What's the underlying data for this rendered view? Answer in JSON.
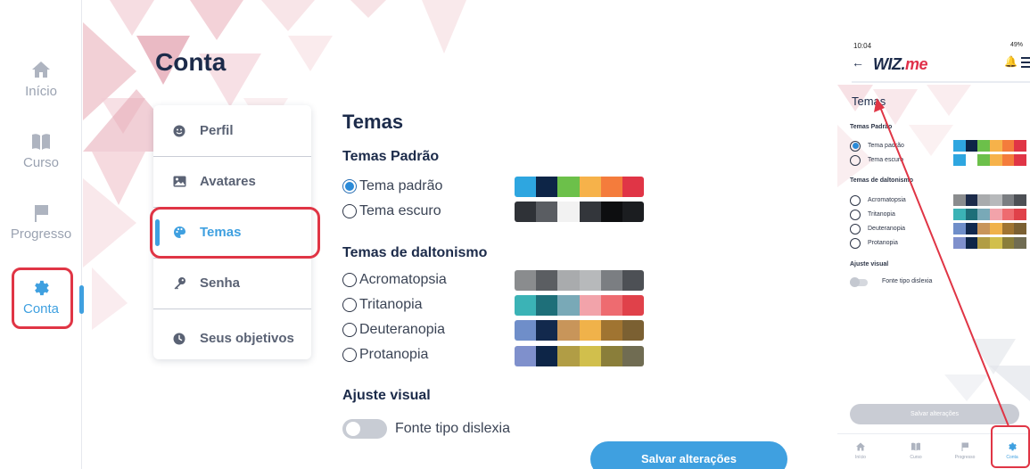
{
  "nav": {
    "items": [
      {
        "label": "Início",
        "icon": "home-icon"
      },
      {
        "label": "Curso",
        "icon": "book-icon"
      },
      {
        "label": "Progresso",
        "icon": "flag-icon"
      },
      {
        "label": "Conta",
        "icon": "gear-icon",
        "active": true
      }
    ]
  },
  "page": {
    "title": "Conta"
  },
  "menu": {
    "items": [
      {
        "label": "Perfil",
        "icon": "smile-icon"
      },
      {
        "label": "Avatares",
        "icon": "image-icon"
      },
      {
        "label": "Temas",
        "icon": "palette-icon",
        "active": true
      },
      {
        "label": "Senha",
        "icon": "key-icon"
      },
      {
        "label": "Seus objetivos",
        "icon": "clock-icon"
      }
    ]
  },
  "themes": {
    "title": "Temas",
    "default_section": "Temas Padrão",
    "default_options": [
      {
        "label": "Tema padrão",
        "selected": true,
        "colors": [
          "#2ea6e0",
          "#0d2547",
          "#6cc04a",
          "#f6b24a",
          "#f47c3c",
          "#e03546"
        ]
      },
      {
        "label": "Tema escuro",
        "selected": false,
        "colors": [
          "#2f3237",
          "#5a5d62",
          "#f2f2f2",
          "#33363b",
          "#0d0e10",
          "#1b1d20"
        ]
      }
    ],
    "colorblind_section": "Temas de daltonismo",
    "colorblind_options": [
      {
        "label": "Acromatopsia",
        "selected": false,
        "colors": [
          "#8a8c8e",
          "#5b5e62",
          "#a9abad",
          "#b7b9bb",
          "#7b7e82",
          "#4d5055"
        ]
      },
      {
        "label": "Tritanopia",
        "selected": false,
        "colors": [
          "#3bb3b6",
          "#1e6f79",
          "#79a9b7",
          "#f2a3aa",
          "#ee6b70",
          "#e0414a"
        ]
      },
      {
        "label": "Deuteranopia",
        "selected": false,
        "colors": [
          "#6f8ec9",
          "#12294d",
          "#c8955a",
          "#f0b24a",
          "#a07431",
          "#7b6032"
        ]
      },
      {
        "label": "Protanopia",
        "selected": false,
        "colors": [
          "#7f90cc",
          "#0d2547",
          "#b19d45",
          "#d1bf4c",
          "#8a7e3a",
          "#706c52"
        ]
      }
    ],
    "visual_section": "Ajuste visual",
    "dyslexia_label": "Fonte tipo dislexia",
    "save_label": "Salvar alterações"
  },
  "phone": {
    "time": "10:04",
    "status_right": "49%",
    "logo_prefix": "WIZ.",
    "logo_suffix": "me",
    "title": "Temas",
    "default_section": "Temas Padrão",
    "default_options": [
      {
        "label": "Tema padrão",
        "selected": true,
        "colors": [
          "#2ea6e0",
          "#0d2547",
          "#6cc04a",
          "#f6b24a",
          "#f47c3c",
          "#e03546"
        ]
      },
      {
        "label": "Tema escuro",
        "selected": false,
        "colors": [
          "#2ea6e0",
          "#ffffff",
          "#6cc04a",
          "#f6b24a",
          "#f47c3c",
          "#e03546"
        ]
      }
    ],
    "colorblind_section": "Temas de daltonismo",
    "colorblind_options": [
      {
        "label": "Acromatopsia",
        "selected": false,
        "colors": [
          "#8a8c8e",
          "#1c2b4a",
          "#a9abad",
          "#b7b9bb",
          "#7b7e82",
          "#4d5055"
        ]
      },
      {
        "label": "Tritanopia",
        "selected": false,
        "colors": [
          "#3bb3b6",
          "#1e6f79",
          "#79a9b7",
          "#f2a3aa",
          "#ee6b70",
          "#e0414a"
        ]
      },
      {
        "label": "Deuteranopia",
        "selected": false,
        "colors": [
          "#6f8ec9",
          "#12294d",
          "#c8955a",
          "#f0b24a",
          "#a07431",
          "#7b6032"
        ]
      },
      {
        "label": "Protanopia",
        "selected": false,
        "colors": [
          "#7f90cc",
          "#0d2547",
          "#b19d45",
          "#d1bf4c",
          "#8a7e3a",
          "#706c52"
        ]
      }
    ],
    "visual_section": "Ajuste visual",
    "dyslexia_label": "Fonte tipo dislexia",
    "save_label": "Salvar alterações",
    "nav": [
      {
        "label": "Início",
        "icon": "home-icon"
      },
      {
        "label": "Curso",
        "icon": "book-icon"
      },
      {
        "label": "Progresso",
        "icon": "flag-icon"
      },
      {
        "label": "Conta",
        "icon": "gear-icon",
        "active": true
      }
    ]
  },
  "colors": {
    "accent": "#3fa0e0",
    "highlight": "#e03545",
    "text": "#1c2b4a"
  }
}
